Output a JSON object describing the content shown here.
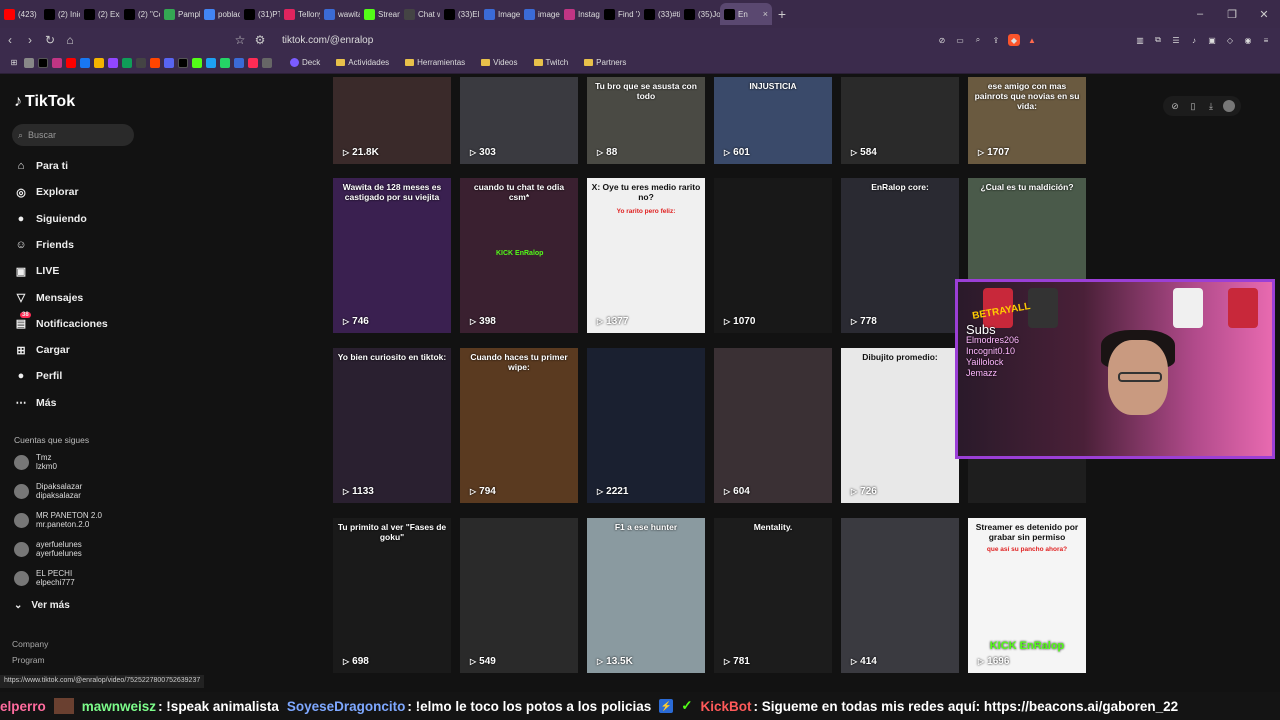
{
  "browser": {
    "tabs": [
      {
        "label": "(423)",
        "icon": "youtube-icon",
        "color": "#ff0000"
      },
      {
        "label": "(2) Inic",
        "icon": "x-icon",
        "color": "#000000"
      },
      {
        "label": "(2) Expl",
        "icon": "x-icon",
        "color": "#000000"
      },
      {
        "label": "(2) \"Co",
        "icon": "x-icon",
        "color": "#000000"
      },
      {
        "label": "Pamplo",
        "icon": "maps-icon",
        "color": "#34a853"
      },
      {
        "label": "poblac",
        "icon": "google-icon",
        "color": "#4285f4"
      },
      {
        "label": "(31)PTI",
        "icon": "tiktok-icon",
        "color": "#000000"
      },
      {
        "label": "Tellony",
        "icon": "app-icon",
        "color": "#e0245e"
      },
      {
        "label": "wawita",
        "icon": "p-icon",
        "color": "#3b6bd6"
      },
      {
        "label": "Stream",
        "icon": "kick-icon",
        "color": "#53fc18"
      },
      {
        "label": "Chat w",
        "icon": "chat-icon",
        "color": "#444444"
      },
      {
        "label": "(33)El",
        "icon": "tiktok-icon",
        "color": "#000000"
      },
      {
        "label": "Image",
        "icon": "p-icon",
        "color": "#3b6bd6"
      },
      {
        "label": "image.j",
        "icon": "p-icon",
        "color": "#3b6bd6"
      },
      {
        "label": "Instagr",
        "icon": "instagram-icon",
        "color": "#c13584"
      },
      {
        "label": "Find 'X",
        "icon": "tiktok-icon",
        "color": "#000000"
      },
      {
        "label": "(33)#ti",
        "icon": "tiktok-icon",
        "color": "#000000"
      },
      {
        "label": "(35)Jos",
        "icon": "tiktok-icon",
        "color": "#000000"
      },
      {
        "label": "En",
        "icon": "tiktok-icon",
        "color": "#000000",
        "active": true
      }
    ],
    "url": "tiktok.com/@enralop",
    "bookmarks": {
      "folders": [
        "Deck",
        "Actividades",
        "Herramientas",
        "Videos",
        "Twitch",
        "Partners"
      ]
    }
  },
  "sidebar": {
    "brand": "TikTok",
    "search_placeholder": "Buscar",
    "nav": [
      {
        "label": "Para ti",
        "icon": "home-icon"
      },
      {
        "label": "Explorar",
        "icon": "compass-icon"
      },
      {
        "label": "Siguiendo",
        "icon": "following-icon"
      },
      {
        "label": "Friends",
        "icon": "friends-icon"
      },
      {
        "label": "LIVE",
        "icon": "live-icon"
      },
      {
        "label": "Mensajes",
        "icon": "messages-icon"
      },
      {
        "label": "Notificaciones",
        "icon": "notifications-icon",
        "badge": "38"
      },
      {
        "label": "Cargar",
        "icon": "upload-icon"
      },
      {
        "label": "Perfil",
        "icon": "profile-icon"
      },
      {
        "label": "Más",
        "icon": "more-icon"
      }
    ],
    "following_header": "Cuentas que sigues",
    "following": [
      {
        "name": "Tmz",
        "handle": "lzkm0"
      },
      {
        "name": "Dipaksalazar",
        "handle": "dipaksalazar"
      },
      {
        "name": "MR PANETON 2.0",
        "handle": "mr.paneton.2.0"
      },
      {
        "name": "ayerfuelunes",
        "handle": "ayerfuelunes"
      },
      {
        "name": "EL PECHI",
        "handle": "elpechi777"
      }
    ],
    "see_more": "Ver más",
    "footer": [
      "Company",
      "Program"
    ]
  },
  "videos": [
    {
      "views": "21.8K",
      "caption": ""
    },
    {
      "views": "303",
      "caption": ""
    },
    {
      "views": "88",
      "caption": "Tu bro que se asusta con todo"
    },
    {
      "views": "601",
      "caption": "INJUSTICIA"
    },
    {
      "views": "584",
      "caption": ""
    },
    {
      "views": "1707",
      "caption": "ese amigo con mas painrots que novias en su vida:"
    },
    {
      "views": "746",
      "caption": "Wawita de 128 meses es castigado por su viejita"
    },
    {
      "views": "398",
      "caption": "cuando tu chat te odia csm*"
    },
    {
      "views": "1377",
      "caption": "X: Oye tu eres medio rarito no?"
    },
    {
      "views": "1070",
      "caption": ""
    },
    {
      "views": "778",
      "caption": "EnRalop core:"
    },
    {
      "views": "",
      "caption": "¿Cual es tu maldición?"
    },
    {
      "views": "1133",
      "caption": "Yo bien curiosito en tiktok:"
    },
    {
      "views": "794",
      "caption": "Cuando haces tu primer wipe:"
    },
    {
      "views": "2221",
      "caption": ""
    },
    {
      "views": "604",
      "caption": ""
    },
    {
      "views": "726",
      "caption": "Dibujito promedio:"
    },
    {
      "views": "",
      "caption": ""
    },
    {
      "views": "698",
      "caption": "Tu primito al ver \"Fases de goku\""
    },
    {
      "views": "549",
      "caption": ""
    },
    {
      "views": "13.5K",
      "caption": "F1 a ese hunter"
    },
    {
      "views": "781",
      "caption": "Mentality."
    },
    {
      "views": "414",
      "caption": ""
    },
    {
      "views": "1696",
      "caption": "Streamer es detenido por grabar sin permiso"
    }
  ],
  "card_sub": {
    "x_oye": "Yo rarito pero feliz:",
    "streamer": "que así su pancho ahora?",
    "kick_brand": "KICK EnRalop"
  },
  "overlay": {
    "brand": "BETRAYALL",
    "subs": [
      "Subs",
      "Elmodres206",
      "Incognit0.10",
      "Yaillolock",
      "Jemazz"
    ]
  },
  "status_url": "https://www.tiktok.com/@enralop/video/7525227800752639237",
  "chat": [
    {
      "user": "elperro",
      "msg": ""
    },
    {
      "user": "mawnweisz",
      "msg": ": !speak animalista"
    },
    {
      "user": "SoyeseDragoncito",
      "msg": ": !elmo le toco los potos a los policias"
    },
    {
      "user": "KickBot",
      "msg": ": Sigueme en todas mis redes aquí: https://beacons.ai/gaboren_22"
    }
  ],
  "colors": {
    "accent": "#fe2c55",
    "kick": "#53fc18",
    "overlay_border": "#9b3fd6"
  }
}
